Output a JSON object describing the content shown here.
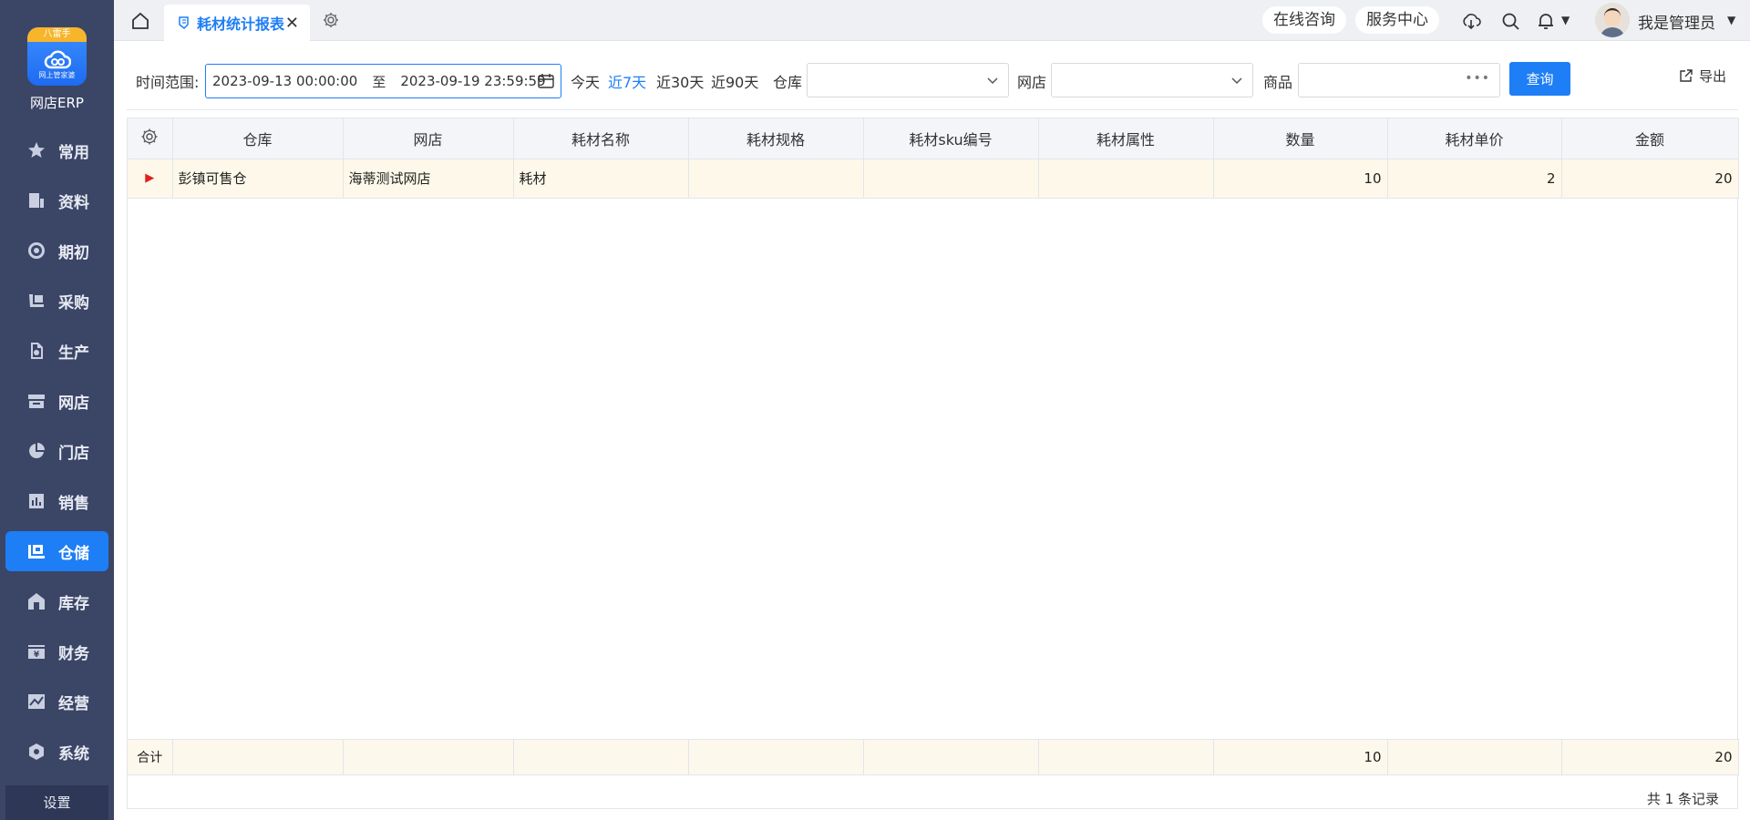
{
  "app": {
    "logo_ribbon": "八雷手",
    "logo_sub": "网上管家婆",
    "brand": "网店ERP"
  },
  "sidebar": {
    "items": [
      {
        "label": "常用",
        "icon": "star-icon"
      },
      {
        "label": "资料",
        "icon": "document-icon"
      },
      {
        "label": "期初",
        "icon": "target-icon"
      },
      {
        "label": "采购",
        "icon": "cart-icon"
      },
      {
        "label": "生产",
        "icon": "factory-icon"
      },
      {
        "label": "网店",
        "icon": "shop-icon"
      },
      {
        "label": "门店",
        "icon": "pie-icon"
      },
      {
        "label": "销售",
        "icon": "bar-chart-icon"
      },
      {
        "label": "仓储",
        "icon": "warehouse-icon"
      },
      {
        "label": "库存",
        "icon": "home-icon"
      },
      {
        "label": "财务",
        "icon": "finance-icon"
      },
      {
        "label": "经营",
        "icon": "trend-icon"
      },
      {
        "label": "系统",
        "icon": "hexagon-icon"
      }
    ],
    "active_index": 8,
    "bottom_label": "设置"
  },
  "topbar": {
    "tab_label": "耗材统计报表",
    "consult_label": "在线咨询",
    "service_label": "服务中心",
    "username": "我是管理员"
  },
  "filters": {
    "time_label": "时间范围:",
    "date_start": "2023-09-13 00:00:00",
    "date_sep": "至",
    "date_end": "2023-09-19 23:59:59",
    "quick_today": "今天",
    "quick_7": "近7天",
    "quick_30": "近30天",
    "quick_90": "近90天",
    "warehouse_label": "仓库",
    "shop_label": "网店",
    "product_label": "商品",
    "query_label": "查询",
    "export_label": "导出"
  },
  "table": {
    "headers": [
      "仓库",
      "网店",
      "耗材名称",
      "耗材规格",
      "耗材sku编号",
      "耗材属性",
      "数量",
      "耗材单价",
      "金额"
    ],
    "rows": [
      {
        "warehouse": "彭镇可售仓",
        "shop": "海蒂测试网店",
        "name": "耗材",
        "spec": "",
        "sku": "",
        "attr": "",
        "qty": "10",
        "price": "2",
        "amount": "20"
      }
    ],
    "summary": {
      "label": "合计",
      "qty": "10",
      "amount": "20"
    },
    "record_info": "共 1 条记录"
  }
}
